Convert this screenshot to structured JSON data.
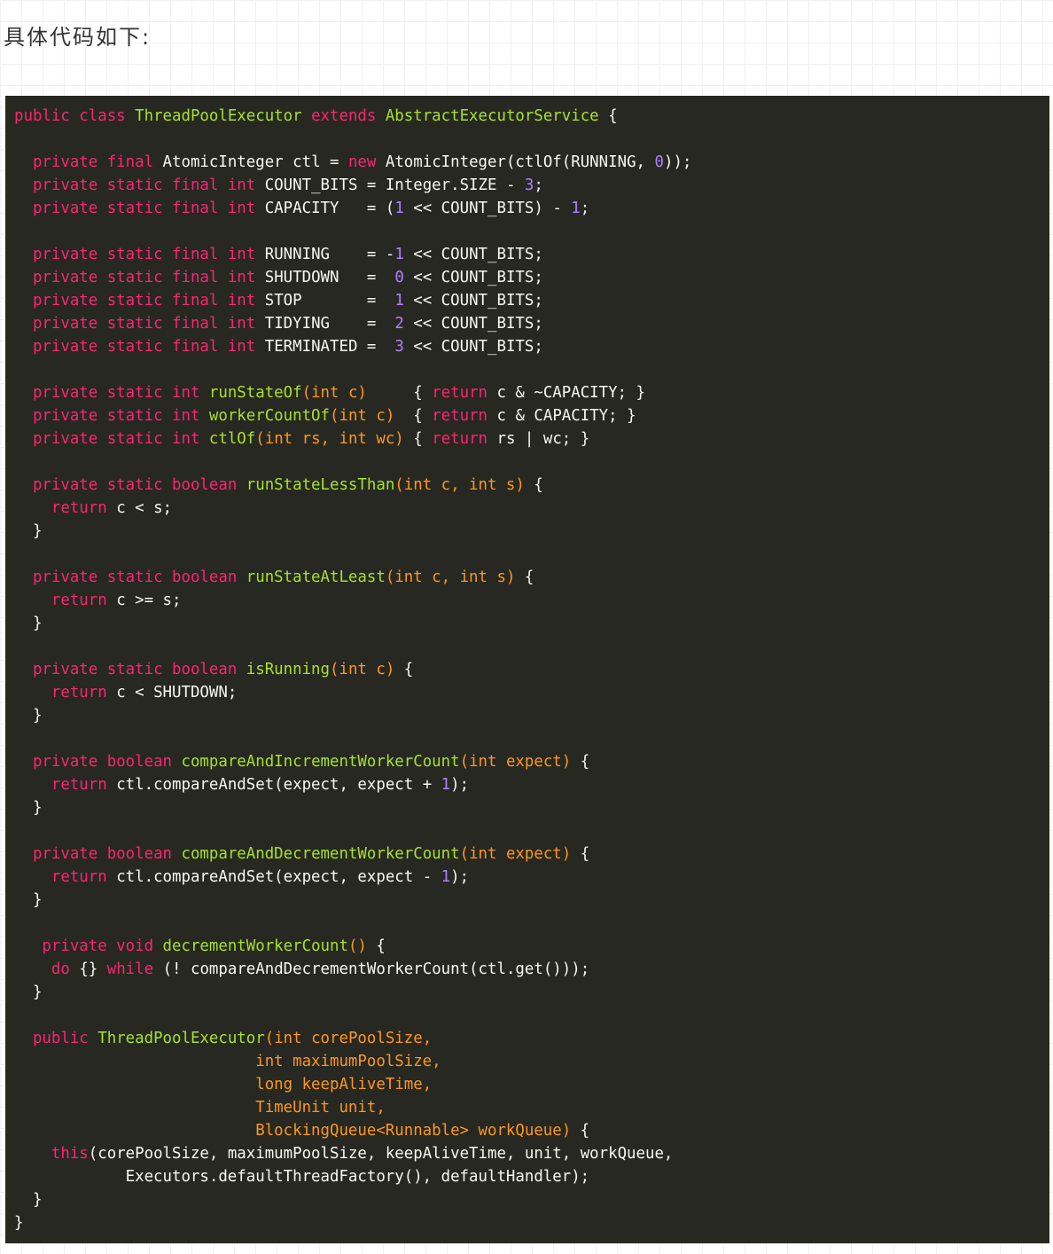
{
  "intro_text": "具体代码如下:",
  "code": {
    "language": "java",
    "lines": [
      [
        [
          "k",
          "public class "
        ],
        [
          "f",
          "ThreadPoolExecutor "
        ],
        [
          "k",
          "extends "
        ],
        [
          "f",
          "AbstractExecutorService "
        ],
        [
          "t",
          "{"
        ]
      ],
      [],
      [
        [
          "t",
          "  "
        ],
        [
          "k",
          "private final "
        ],
        [
          "t",
          "AtomicInteger ctl = "
        ],
        [
          "k",
          "new "
        ],
        [
          "t",
          "AtomicInteger(ctlOf(RUNNING, "
        ],
        [
          "n",
          "0"
        ],
        [
          "t",
          "));"
        ]
      ],
      [
        [
          "t",
          "  "
        ],
        [
          "k",
          "private static final int "
        ],
        [
          "t",
          "COUNT_BITS = Integer.SIZE - "
        ],
        [
          "n",
          "3"
        ],
        [
          "t",
          ";"
        ]
      ],
      [
        [
          "t",
          "  "
        ],
        [
          "k",
          "private static final int "
        ],
        [
          "t",
          "CAPACITY   = ("
        ],
        [
          "n",
          "1"
        ],
        [
          "t",
          " << COUNT_BITS) - "
        ],
        [
          "n",
          "1"
        ],
        [
          "t",
          ";"
        ]
      ],
      [],
      [
        [
          "t",
          "  "
        ],
        [
          "k",
          "private static final int "
        ],
        [
          "t",
          "RUNNING    = -"
        ],
        [
          "n",
          "1"
        ],
        [
          "t",
          " << COUNT_BITS;"
        ]
      ],
      [
        [
          "t",
          "  "
        ],
        [
          "k",
          "private static final int "
        ],
        [
          "t",
          "SHUTDOWN   =  "
        ],
        [
          "n",
          "0"
        ],
        [
          "t",
          " << COUNT_BITS;"
        ]
      ],
      [
        [
          "t",
          "  "
        ],
        [
          "k",
          "private static final int "
        ],
        [
          "t",
          "STOP       =  "
        ],
        [
          "n",
          "1"
        ],
        [
          "t",
          " << COUNT_BITS;"
        ]
      ],
      [
        [
          "t",
          "  "
        ],
        [
          "k",
          "private static final int "
        ],
        [
          "t",
          "TIDYING    =  "
        ],
        [
          "n",
          "2"
        ],
        [
          "t",
          " << COUNT_BITS;"
        ]
      ],
      [
        [
          "t",
          "  "
        ],
        [
          "k",
          "private static final int "
        ],
        [
          "t",
          "TERMINATED =  "
        ],
        [
          "n",
          "3"
        ],
        [
          "t",
          " << COUNT_BITS;"
        ]
      ],
      [],
      [
        [
          "t",
          "  "
        ],
        [
          "k",
          "private static int "
        ],
        [
          "f",
          "runStateOf"
        ],
        [
          "p",
          "(int c)"
        ],
        [
          "t",
          "     { "
        ],
        [
          "k",
          "return "
        ],
        [
          "t",
          "c & ~CAPACITY; }"
        ]
      ],
      [
        [
          "t",
          "  "
        ],
        [
          "k",
          "private static int "
        ],
        [
          "f",
          "workerCountOf"
        ],
        [
          "p",
          "(int c)"
        ],
        [
          "t",
          "  { "
        ],
        [
          "k",
          "return "
        ],
        [
          "t",
          "c & CAPACITY; }"
        ]
      ],
      [
        [
          "t",
          "  "
        ],
        [
          "k",
          "private static int "
        ],
        [
          "f",
          "ctlOf"
        ],
        [
          "p",
          "(int rs, int wc)"
        ],
        [
          "t",
          " { "
        ],
        [
          "k",
          "return "
        ],
        [
          "t",
          "rs | wc; }"
        ]
      ],
      [],
      [
        [
          "t",
          "  "
        ],
        [
          "k",
          "private static boolean "
        ],
        [
          "f",
          "runStateLessThan"
        ],
        [
          "p",
          "(int c, int s)"
        ],
        [
          "t",
          " {"
        ]
      ],
      [
        [
          "t",
          "    "
        ],
        [
          "k",
          "return "
        ],
        [
          "t",
          "c < s;"
        ]
      ],
      [
        [
          "t",
          "  }"
        ]
      ],
      [],
      [
        [
          "t",
          "  "
        ],
        [
          "k",
          "private static boolean "
        ],
        [
          "f",
          "runStateAtLeast"
        ],
        [
          "p",
          "(int c, int s)"
        ],
        [
          "t",
          " {"
        ]
      ],
      [
        [
          "t",
          "    "
        ],
        [
          "k",
          "return "
        ],
        [
          "t",
          "c >= s;"
        ]
      ],
      [
        [
          "t",
          "  }"
        ]
      ],
      [],
      [
        [
          "t",
          "  "
        ],
        [
          "k",
          "private static boolean "
        ],
        [
          "f",
          "isRunning"
        ],
        [
          "p",
          "(int c)"
        ],
        [
          "t",
          " {"
        ]
      ],
      [
        [
          "t",
          "    "
        ],
        [
          "k",
          "return "
        ],
        [
          "t",
          "c < SHUTDOWN;"
        ]
      ],
      [
        [
          "t",
          "  }"
        ]
      ],
      [],
      [
        [
          "t",
          "  "
        ],
        [
          "k",
          "private boolean "
        ],
        [
          "f",
          "compareAndIncrementWorkerCount"
        ],
        [
          "p",
          "(int expect)"
        ],
        [
          "t",
          " {"
        ]
      ],
      [
        [
          "t",
          "    "
        ],
        [
          "k",
          "return "
        ],
        [
          "t",
          "ctl.compareAndSet(expect, expect + "
        ],
        [
          "n",
          "1"
        ],
        [
          "t",
          ");"
        ]
      ],
      [
        [
          "t",
          "  }"
        ]
      ],
      [],
      [
        [
          "t",
          "  "
        ],
        [
          "k",
          "private boolean "
        ],
        [
          "f",
          "compareAndDecrementWorkerCount"
        ],
        [
          "p",
          "(int expect)"
        ],
        [
          "t",
          " {"
        ]
      ],
      [
        [
          "t",
          "    "
        ],
        [
          "k",
          "return "
        ],
        [
          "t",
          "ctl.compareAndSet(expect, expect - "
        ],
        [
          "n",
          "1"
        ],
        [
          "t",
          ");"
        ]
      ],
      [
        [
          "t",
          "  }"
        ]
      ],
      [],
      [
        [
          "t",
          "   "
        ],
        [
          "k",
          "private void "
        ],
        [
          "f",
          "decrementWorkerCount"
        ],
        [
          "p",
          "()"
        ],
        [
          "t",
          " {"
        ]
      ],
      [
        [
          "t",
          "    "
        ],
        [
          "k",
          "do "
        ],
        [
          "t",
          "{} "
        ],
        [
          "k",
          "while "
        ],
        [
          "t",
          "(! compareAndDecrementWorkerCount(ctl.get()));"
        ]
      ],
      [
        [
          "t",
          "  }"
        ]
      ],
      [],
      [
        [
          "t",
          "  "
        ],
        [
          "k",
          "public "
        ],
        [
          "f",
          "ThreadPoolExecutor"
        ],
        [
          "p",
          "(int corePoolSize,"
        ]
      ],
      [
        [
          "p",
          "                          int maximumPoolSize,"
        ]
      ],
      [
        [
          "p",
          "                          long keepAliveTime,"
        ]
      ],
      [
        [
          "p",
          "                          TimeUnit unit,"
        ]
      ],
      [
        [
          "p",
          "                          BlockingQueue<Runnable> workQueue)"
        ],
        [
          "t",
          " {"
        ]
      ],
      [
        [
          "t",
          "    "
        ],
        [
          "k",
          "this"
        ],
        [
          "t",
          "(corePoolSize, maximumPoolSize, keepAliveTime, unit, workQueue,"
        ]
      ],
      [
        [
          "t",
          "            Executors.defaultThreadFactory(), defaultHandler);"
        ]
      ],
      [
        [
          "t",
          "  }"
        ]
      ],
      [
        [
          "t",
          "}"
        ]
      ]
    ]
  }
}
